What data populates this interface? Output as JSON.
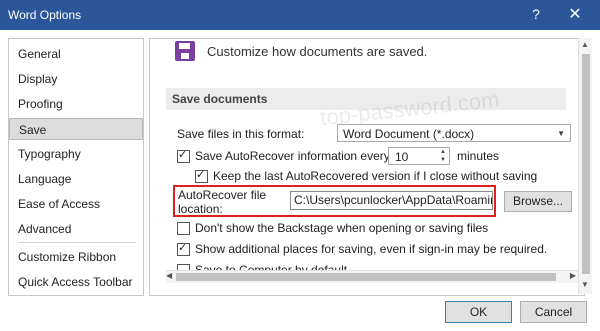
{
  "window": {
    "title": "Word Options",
    "help": "?",
    "close": "✕"
  },
  "sidebar": {
    "items": [
      {
        "label": "General"
      },
      {
        "label": "Display"
      },
      {
        "label": "Proofing"
      },
      {
        "label": "Save"
      },
      {
        "label": "Typography"
      },
      {
        "label": "Language"
      },
      {
        "label": "Ease of Access"
      },
      {
        "label": "Advanced"
      },
      {
        "label": "Customize Ribbon"
      },
      {
        "label": "Quick Access Toolbar"
      }
    ],
    "selected": "Save"
  },
  "header": {
    "text": "Customize how documents are saved."
  },
  "watermark": "top-password.com",
  "section": {
    "title": "Save documents"
  },
  "format": {
    "label": "Save files in this format:",
    "value": "Word Document (*.docx)"
  },
  "autorecover": {
    "label": "Save AutoRecover information every",
    "value": "10",
    "unit": "minutes"
  },
  "keep_last": {
    "label": "Keep the last AutoRecovered version if I close without saving"
  },
  "location": {
    "label_line1": "AutoRecover file",
    "label_line2": "location:",
    "value": "C:\\Users\\pcunlocker\\AppData\\Roaming",
    "browse": "Browse..."
  },
  "backstage": {
    "label": "Don't show the Backstage when opening or saving files"
  },
  "additional": {
    "label": "Show additional places for saving, even if sign-in may be required."
  },
  "save_computer": {
    "label": "Save to Computer by default"
  },
  "footer": {
    "ok": "OK",
    "cancel": "Cancel"
  }
}
